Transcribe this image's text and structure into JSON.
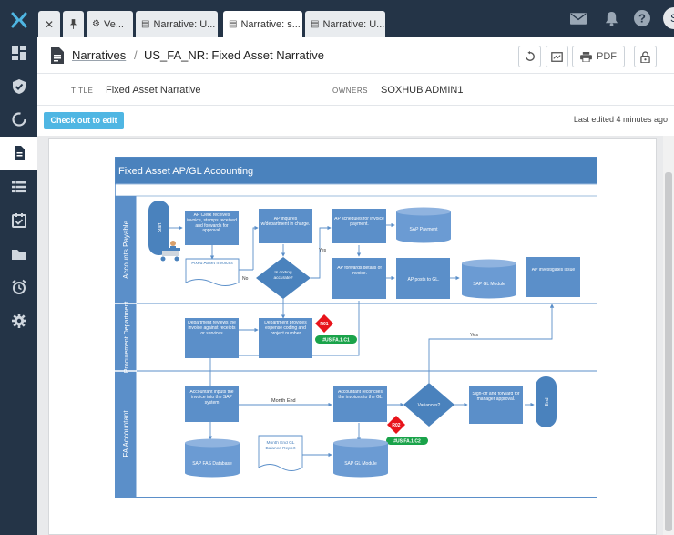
{
  "tabs": [
    {
      "label": "Ve..."
    },
    {
      "label": "Narrative: U..."
    },
    {
      "label": "Narrative: s..."
    },
    {
      "label": "Narrative: U..."
    }
  ],
  "user": {
    "initial": "S"
  },
  "breadcrumb": {
    "root": "Narratives",
    "separator": "/",
    "title": "US_FA_NR: Fixed Asset Narrative"
  },
  "toolbar": {
    "pdf_label": "PDF"
  },
  "meta": {
    "title_label": "TITLE",
    "title_value": "Fixed Asset Narrative",
    "owners_label": "OWNERS",
    "owners_value": "SOXHUB ADMIN1"
  },
  "actions": {
    "checkout_label": "Check out to edit",
    "last_edited": "Last edited 4 minutes ago"
  },
  "diagram": {
    "title": "Fixed Asset AP/GL Accounting",
    "lanes": [
      "Accounts Payable",
      "Procurement Department",
      "FA Accountant"
    ],
    "start": "Start",
    "end": "End",
    "ap_clerk": "AP Clerk receives invoice, stamps received and forwards for approval.",
    "fixed_asset_invoices": "Fixed Asset Invoices",
    "ap_inquires": "AP inquires w/department in charge.",
    "is_coding_accurate": "Is coding accurate?",
    "no_label": "No",
    "yes_label": "Yes",
    "ap_schedules": "AP schedules for invoice payment.",
    "sap_payment": "SAP Payment",
    "ap_forwards": "AP forwards details of invoice.",
    "ap_posts": "AP posts to GL.",
    "sap_gl_module": "SAP GL Module",
    "ap_investigates": "AP investigates issue",
    "dept_reviews": "Department reviews the invoice against receipts or services",
    "dept_provides": "Department provides expense coding and project number",
    "risk1": "R01",
    "control1": "#US.FA.1.C1",
    "accountant_inputs": "Accountant inputs the invoice into the SAP system",
    "month_end": "Month End",
    "accountant_reconciles": "Accountant reconciles the invoices to the GL",
    "variances": "Variances?",
    "signoff": "Sign-off and forward for manager approval.",
    "risk2": "R02",
    "control2": "#US.FA.1.C2",
    "sap_fas_db": "SAP FAS Database",
    "month_end_report": "Month End GL Balance Report",
    "sap_gl_module2": "SAP GL Module"
  },
  "colors": {
    "sidebar": "#243447",
    "accent": "#4fb6e3",
    "diagram_blue": "#5b8fc9",
    "diagram_header": "#4a82bd",
    "risk": "#e8141b",
    "control": "#1aa34a"
  }
}
